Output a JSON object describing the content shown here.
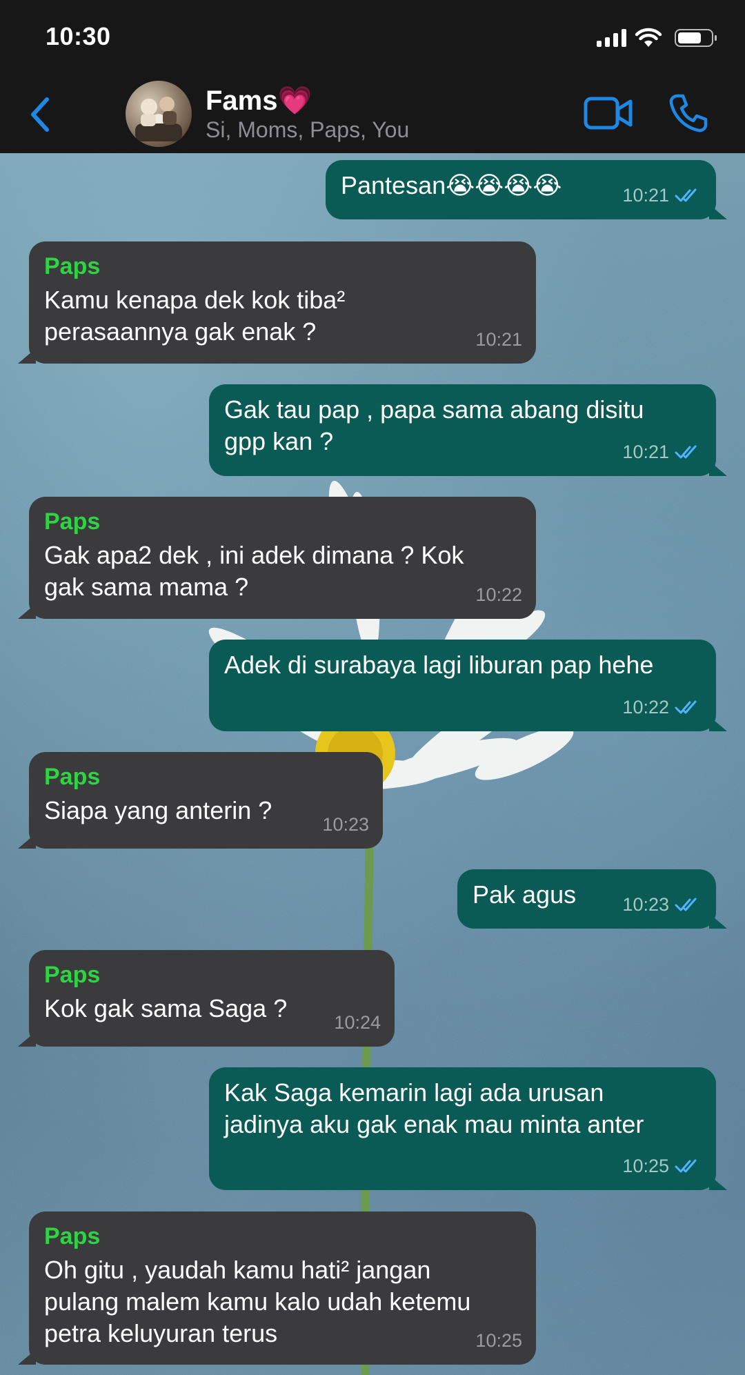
{
  "status_bar": {
    "time": "10:30",
    "battery_level": 0.75
  },
  "header": {
    "title": "Fams💗",
    "subtitle": "Si, Moms, Paps, You",
    "back_icon": "chevron-left-icon",
    "video_icon": "video-camera-icon",
    "call_icon": "phone-icon",
    "accent_color": "#1e88e5"
  },
  "colors": {
    "incoming_bubble": "#3b3b3d",
    "outgoing_bubble": "#0a5b55",
    "sender_name": "#2fd343",
    "read_ticks": "#4fb3ff"
  },
  "messages": [
    {
      "direction": "out",
      "text": "Pantesan😭😭😭😭",
      "time": "10:21",
      "status": "read"
    },
    {
      "direction": "in",
      "sender": "Paps",
      "text": "Kamu kenapa dek kok tiba²\nperasaannya gak enak ?",
      "time": "10:21"
    },
    {
      "direction": "out",
      "text": "Gak tau pap , papa sama abang disitu\ngpp kan ?",
      "time": "10:21",
      "status": "read"
    },
    {
      "direction": "in",
      "sender": "Paps",
      "text": "Gak apa2 dek , ini adek dimana ? Kok\ngak sama mama ?",
      "time": "10:22"
    },
    {
      "direction": "out",
      "text": "Adek di surabaya lagi liburan pap hehe",
      "time": "10:22",
      "status": "read"
    },
    {
      "direction": "in",
      "sender": "Paps",
      "text": "Siapa yang anterin ?",
      "time": "10:23"
    },
    {
      "direction": "out",
      "text": "Pak agus",
      "time": "10:23",
      "status": "read"
    },
    {
      "direction": "in",
      "sender": "Paps",
      "text": "Kok gak sama Saga ?",
      "time": "10:24"
    },
    {
      "direction": "out",
      "text": "Kak Saga kemarin lagi ada urusan\njadinya aku gak enak mau minta anter",
      "time": "10:25",
      "status": "read"
    },
    {
      "direction": "in",
      "sender": "Paps",
      "text": "Oh gitu , yaudah kamu hati² jangan\npulang malem kamu kalo udah ketemu\npetra keluyuran terus",
      "time": "10:25"
    }
  ]
}
